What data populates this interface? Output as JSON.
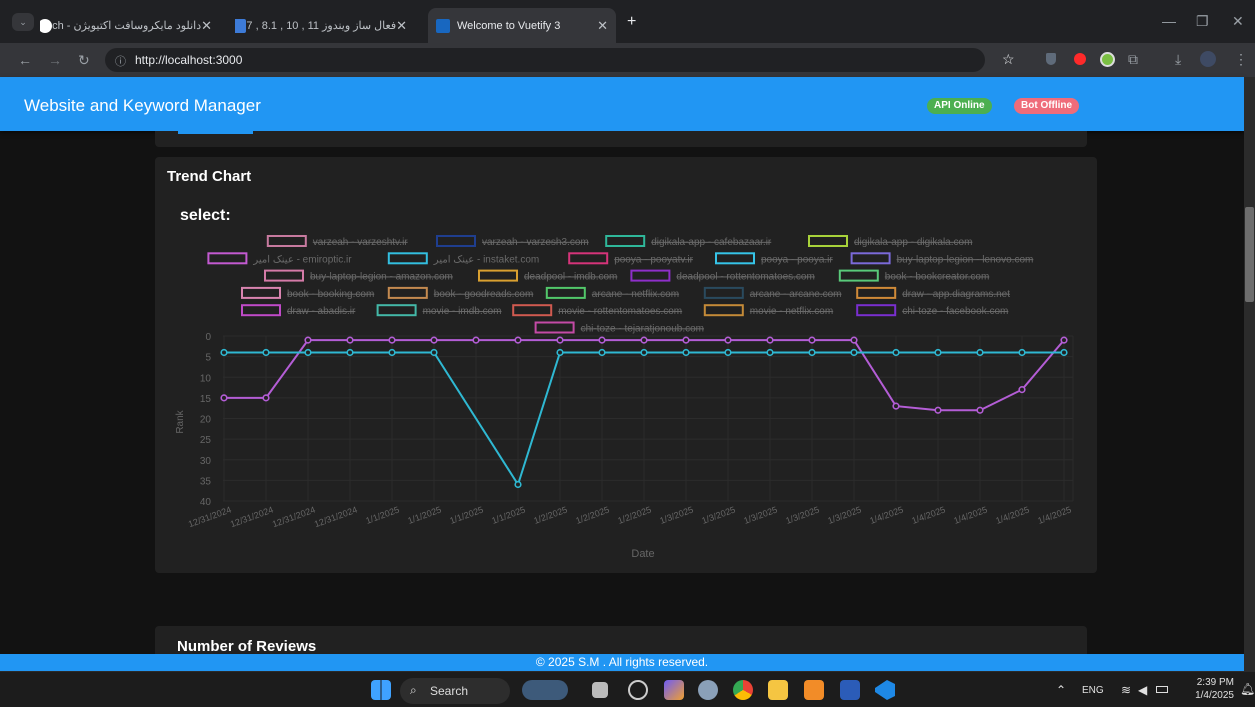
{
  "browser": {
    "tabs": [
      {
        "label": "دانلود مایکروسافت اکتیویژن - ch",
        "fav_color": "#ffffff"
      },
      {
        "label": "فعال ساز ویندوز 11 , 10 , 8.1 , 7",
        "fav_color": "#3d7bd8"
      },
      {
        "label": "Welcome to Vuetify 3",
        "fav_color": "#1867c0"
      }
    ],
    "new_tab": "+",
    "url": "http://localhost:3000"
  },
  "app": {
    "title": "Website and Keyword Manager",
    "api_status": "API Online",
    "bot_status": "Bot Offline",
    "api_color": "#4caf50",
    "bot_color": "#ef5350"
  },
  "trend": {
    "title": "Trend Chart",
    "select_label": "select:"
  },
  "reviews": {
    "title": "Number of Reviews"
  },
  "footer": {
    "text": "© 2025 S.M . All rights reserved."
  },
  "taskbar": {
    "search_label": "Search",
    "lang": "ENG",
    "time": "2:39 PM",
    "date": "1/4/2025"
  },
  "chart_data": {
    "type": "line",
    "xlabel": "Date",
    "ylabel": "Rank",
    "ylim": [
      0,
      40
    ],
    "y_ticks": [
      0,
      5,
      10,
      15,
      20,
      25,
      30,
      35,
      40
    ],
    "y_reversed": true,
    "grid": true,
    "legend_position": "top",
    "categories": [
      "12/31/2024",
      "12/31/2024",
      "12/31/2024",
      "12/31/2024",
      "1/1/2025",
      "1/1/2025",
      "1/1/2025",
      "1/1/2025",
      "1/2/2025",
      "1/2/2025",
      "1/2/2025",
      "1/3/2025",
      "1/3/2025",
      "1/3/2025",
      "1/3/2025",
      "1/3/2025",
      "1/4/2025",
      "1/4/2025",
      "1/4/2025",
      "1/4/2025",
      "1/4/2025"
    ],
    "legend": [
      {
        "label": "varzeah - varzeshtv.ir",
        "color": "#c77a9f",
        "hidden": true
      },
      {
        "label": "varzeah - varzesh3.com",
        "color": "#1f3e8f",
        "hidden": true
      },
      {
        "label": "digikala-app - cafebazaar.ir",
        "color": "#2fb79a",
        "hidden": true
      },
      {
        "label": "digikala-app - digikala.com",
        "color": "#a8d23a",
        "hidden": true
      },
      {
        "label": "عینک امیر - emiroptic.ir",
        "color": "#c35ad1",
        "hidden": false
      },
      {
        "label": "عینک امیر - instaket.com",
        "color": "#33bfe0",
        "hidden": false
      },
      {
        "label": "pooya - pooyatv.ir",
        "color": "#d6347a",
        "hidden": true
      },
      {
        "label": "pooya - pooya.ir",
        "color": "#36c4e8",
        "hidden": true
      },
      {
        "label": "buy-laptop-legion - lenovo.com",
        "color": "#7b6ad9",
        "hidden": true
      },
      {
        "label": "buy-laptop-legion - amazon.com",
        "color": "#d47aa7",
        "hidden": true
      },
      {
        "label": "deadpool - imdb.com",
        "color": "#d9a030",
        "hidden": true
      },
      {
        "label": "deadpool - rottentomatoes.com",
        "color": "#8e2fc9",
        "hidden": true
      },
      {
        "label": "book - bookcreator.com",
        "color": "#59c97a",
        "hidden": true
      },
      {
        "label": "book - booking.com",
        "color": "#d984b0",
        "hidden": true
      },
      {
        "label": "book - goodreads.com",
        "color": "#c48a50",
        "hidden": true
      },
      {
        "label": "arcane - netflix.com",
        "color": "#52c76a",
        "hidden": true
      },
      {
        "label": "arcane - arcane.com",
        "color": "#2a4a5e",
        "hidden": true
      },
      {
        "label": "draw - app.diagrams.net",
        "color": "#d08a38",
        "hidden": true
      },
      {
        "label": "draw - abadis.ir",
        "color": "#c04ac8",
        "hidden": true
      },
      {
        "label": "movie - imdb.com",
        "color": "#44b8a8",
        "hidden": true
      },
      {
        "label": "movie - rottentomatoes.com",
        "color": "#d05a50",
        "hidden": true
      },
      {
        "label": "movie - netflix.com",
        "color": "#c48a38",
        "hidden": true
      },
      {
        "label": "chi-toze - facebook.com",
        "color": "#7a2fd0",
        "hidden": true
      },
      {
        "label": "chi-toze - tejaratjonoub.com",
        "color": "#c44aa6",
        "hidden": true
      }
    ],
    "series": [
      {
        "name": "عینک امیر - emiroptic.ir",
        "color": "#b45dd6",
        "values": [
          15,
          15,
          1,
          1,
          1,
          1,
          1,
          1,
          1,
          1,
          1,
          1,
          1,
          1,
          1,
          1,
          17,
          18,
          18,
          13,
          1
        ]
      },
      {
        "name": "عینک امیر - instaket.com",
        "color": "#2fb8d2",
        "values": [
          4,
          4,
          4,
          4,
          4,
          4,
          null,
          36,
          4,
          4,
          4,
          4,
          4,
          4,
          4,
          4,
          4,
          4,
          4,
          4,
          4
        ]
      }
    ]
  }
}
